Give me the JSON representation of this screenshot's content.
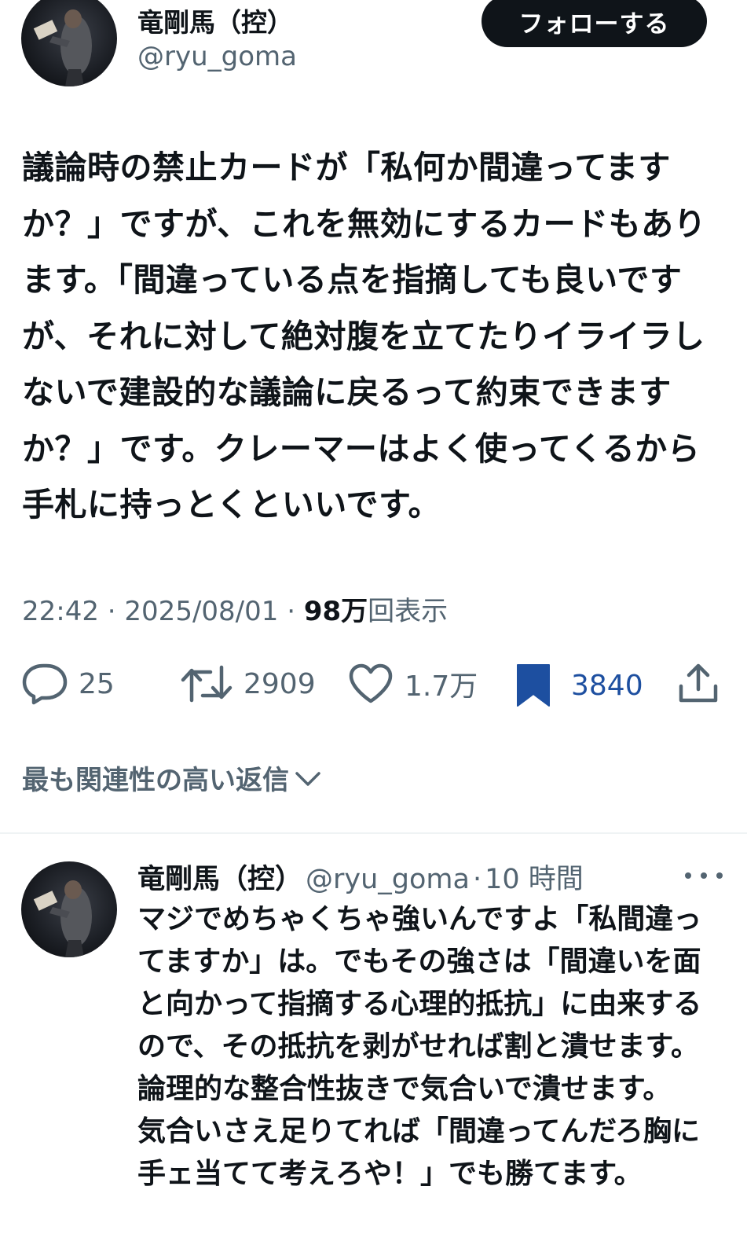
{
  "tweet": {
    "author": {
      "name": "竜剛馬（控）",
      "handle": "@ryu_goma"
    },
    "follow_label": "フォローする",
    "text": "議論時の禁止カードが「私何か間違ってますか？」ですが、これを無効にするカードもあります。「間違っている点を指摘しても良いですが、それに対して絶対腹を立てたりイライラしないで建設的な議論に戻るって約束できますか？」です。クレーマーはよく使ってくるから手札に持っとくといいです。",
    "time": "22:42",
    "date": "2025/08/01",
    "separator": "·",
    "views_count": "98万",
    "views_label": "回表示",
    "stats": {
      "replies": "25",
      "retweets": "2909",
      "likes": "1.7万",
      "bookmarks": "3840"
    }
  },
  "replies_sort_label": "最も関連性の高い返信",
  "reply": {
    "author_name": "竜剛馬（控）",
    "author_handle": "@ryu_goma",
    "separator": "·",
    "time": "10 時間",
    "text": "マジでめちゃくちゃ強いんですよ「私間違ってますか」は。でもその強さは「間違いを面と向かって指摘する心理的抵抗」に由来するので、その抵抗を剥がせれば割と潰せます。論理的な整合性抜きで気合いで潰せます。\n気合いさえ足りてれば「間違ってんだろ胸に手ェ当てて考えろや！」でも勝てます。"
  },
  "colors": {
    "text_primary": "#0f1419",
    "text_secondary": "#536471",
    "bookmark_active": "#1d4fa0",
    "follow_button_bg": "#0f1419",
    "divider": "#eff3f4"
  },
  "icons": {
    "reply": "reply-icon",
    "retweet": "retweet-icon",
    "like": "heart-icon",
    "bookmark": "bookmark-filled-icon",
    "share": "share-icon",
    "sort": "chevron-down-icon",
    "more": "more-horizontal-icon"
  }
}
